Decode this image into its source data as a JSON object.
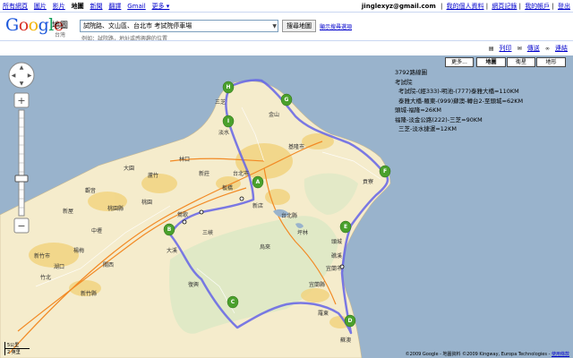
{
  "nav": {
    "items": [
      "所有網頁",
      "圖片",
      "影片"
    ],
    "current": "地圖",
    "items2": [
      "新聞",
      "翻譯",
      "Gmail",
      "更多 ▾"
    ],
    "user": "jinglexyz@gmail.com",
    "links": [
      "我的個人資料",
      "網頁記錄",
      "我的帳戶",
      "登出"
    ]
  },
  "logo": {
    "text": "Google",
    "product": "地圖",
    "region": "台灣"
  },
  "search": {
    "value": "試院路、文山區、台北市 考試院停車場",
    "hint": "例如：試院路，地址或感興趣的位置",
    "button": "搜尋地圖",
    "options": "顯示搜尋選項"
  },
  "toolbar": {
    "print": "列印",
    "send": "傳送",
    "link": "連結"
  },
  "map_buttons": {
    "more": "更多...",
    "map": "地圖",
    "satellite": "衛星",
    "terrain": "地形"
  },
  "route": {
    "title": "3792路線圖",
    "origin": "考試院",
    "lines": [
      "考試院-(經333)-明池-(777)泰雅大橋=110KM",
      "泰雅大橋-羅東-(999)蘇澳-轉台2-至頭城=62KM",
      "頭城-福隆=26KM",
      "福隆-淡金公路(222)-三芝=90KM",
      "三芝-淡水捷運=12KM"
    ]
  },
  "map_labels": {
    "keelung": "基隆市",
    "taipei": "台北市",
    "taipeicounty": "台北縣",
    "taoyuan": "桃園縣",
    "hsinchu": "新竹市",
    "hsinchucounty": "新竹縣",
    "yilan": "宜蘭縣",
    "luodong": "羅東",
    "yilancity": "宜蘭市",
    "jiaoxi": "礁溪",
    "toucheng": "頭城",
    "gongliao": "貢寮",
    "zhongli": "中壢",
    "taoyuancity": "桃園",
    "linkou": "林口",
    "danshui": "淡水",
    "sanzhi": "三芝",
    "jinshan": "金山",
    "banqiao": "板橋",
    "xinzhuang": "新莊",
    "sanxia": "三峽",
    "wulai": "烏來",
    "xindian": "新店",
    "pinglin": "坪林",
    "daxi": "大溪",
    "yingge": "鶯歌",
    "luzhu": "蘆竹",
    "dayuan": "大園",
    "guanyin": "觀音",
    "xinwu": "新屋",
    "yangmei": "楊梅",
    "hukou": "湖口",
    "zhubei": "竹北",
    "guanxi": "關西",
    "fuxing": "復興",
    "suao": "蘇澳"
  },
  "copyright": "©2009 Google - 地圖資料 ©2009 Kingway, Europa Technologies - ",
  "terms": "使用條款",
  "scale": {
    "top": "5公里",
    "bottom": "2 英里"
  },
  "markers": [
    "A",
    "B",
    "C",
    "D",
    "E",
    "F",
    "G",
    "H",
    "I"
  ],
  "colors": {
    "route": "#6464e6",
    "land": "#f5eccc",
    "sea": "#99b3cc",
    "marker": "#4aa02c",
    "link": "#0000cc"
  }
}
